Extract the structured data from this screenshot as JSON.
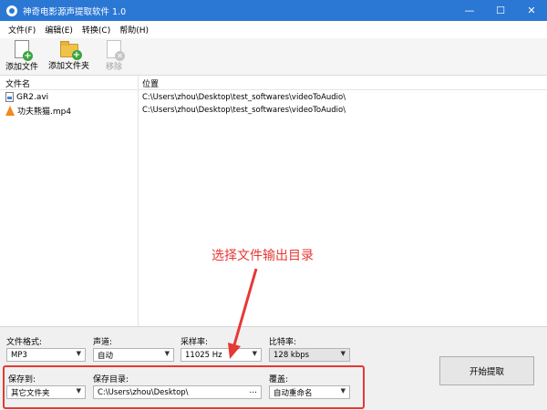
{
  "window": {
    "title": "神奇电影源声提取软件 1.0",
    "controls": [
      "—",
      "☐",
      "✕"
    ]
  },
  "menu": [
    "文件(F)",
    "编辑(E)",
    "转换(C)",
    "帮助(H)"
  ],
  "toolbar": {
    "add_file": "添加文件",
    "add_folder": "添加文件夹",
    "remove": "移除"
  },
  "list": {
    "headers": {
      "name": "文件名",
      "location": "位置"
    },
    "rows": [
      {
        "name": "GR2.avi",
        "path": "C:\\Users\\zhou\\Desktop\\test_softwares\\videoToAudio\\",
        "icon": "video-file-icon"
      },
      {
        "name": "功夫熊猫.mp4",
        "path": "C:\\Users\\zhou\\Desktop\\test_softwares\\videoToAudio\\",
        "icon": "vlc-cone-icon"
      }
    ]
  },
  "settings": {
    "format_label": "文件格式:",
    "format_value": "MP3",
    "channel_label": "声道:",
    "channel_value": "自动",
    "samplerate_label": "采样率:",
    "samplerate_value": "11025 Hz",
    "bitrate_label": "比特率:",
    "bitrate_value": "128 kbps",
    "saveto_label": "保存到:",
    "saveto_value": "其它文件夹",
    "savedir_label": "保存目录:",
    "savedir_value": "C:\\Users\\zhou\\Desktop\\",
    "browse_label": "...",
    "overwrite_label": "覆盖:",
    "overwrite_value": "自动重命名"
  },
  "start_button": "开始提取",
  "annotation": {
    "text": "选择文件输出目录",
    "color": "#e53935"
  },
  "colors": {
    "titlebar": "#2b77d4",
    "highlight": "#e53935"
  }
}
